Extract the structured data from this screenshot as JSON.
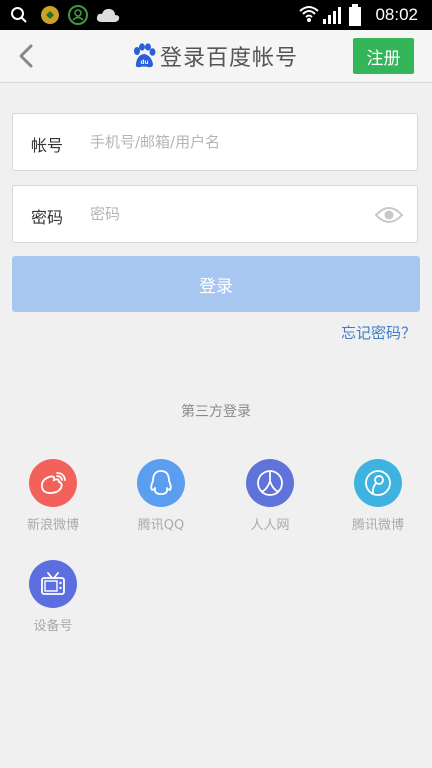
{
  "status_bar": {
    "time": "08:02"
  },
  "header": {
    "title": "登录百度帐号",
    "register_label": "注册"
  },
  "form": {
    "account_label": "帐号",
    "account_placeholder": "手机号/邮箱/用户名",
    "password_label": "密码",
    "password_placeholder": "密码",
    "login_label": "登录",
    "forgot_label": "忘记密码？"
  },
  "third_party": {
    "heading": "第三方登录",
    "items": [
      {
        "label": "新浪微博",
        "icon": "weibo-icon",
        "color": "#f2615a"
      },
      {
        "label": "腾讯QQ",
        "icon": "qq-icon",
        "color": "#5b9ef0"
      },
      {
        "label": "人人网",
        "icon": "renren-icon",
        "color": "#5f73db"
      },
      {
        "label": "腾讯微博",
        "icon": "tencent-weibo-icon",
        "color": "#3fb3e0"
      },
      {
        "label": "设备号",
        "icon": "tv-device-icon",
        "color": "#5d6fe0"
      }
    ]
  },
  "colors": {
    "accent_green": "#35b559",
    "login_button": "#a8c7f0",
    "link_blue": "#3f7cc8"
  }
}
